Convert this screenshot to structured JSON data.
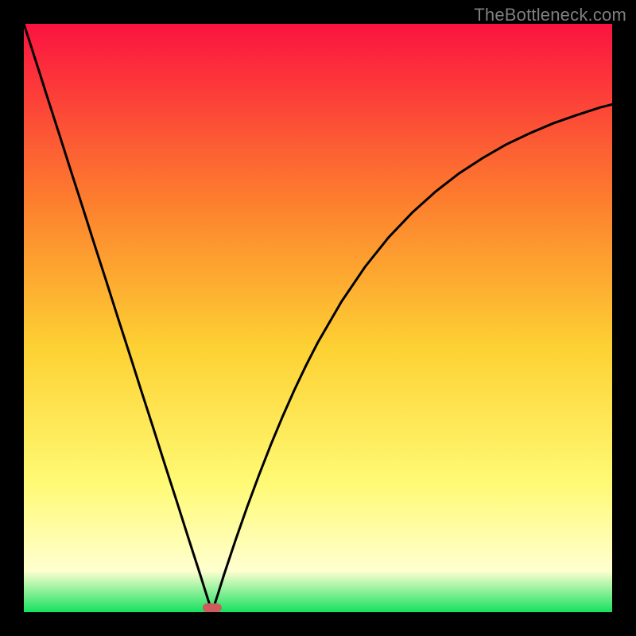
{
  "watermark": "TheBottleneck.com",
  "chart_data": {
    "type": "line",
    "title": "",
    "xlabel": "",
    "ylabel": "",
    "xlim": [
      0,
      100
    ],
    "ylim": [
      0,
      100
    ],
    "grid": false,
    "legend": false,
    "background_gradient": {
      "top": "#fb1340",
      "mid_upper": "#fd7e2e",
      "mid": "#fdd133",
      "mid_lower": "#fffa74",
      "lower": "#ffffd0",
      "bottom": "#16e15f"
    },
    "optimal_marker": {
      "x": 32,
      "color": "#cd5c5c"
    },
    "series": [
      {
        "name": "bottleneck-curve",
        "x": [
          0,
          2,
          4,
          6,
          8,
          10,
          12,
          14,
          16,
          18,
          20,
          22,
          24,
          26,
          28,
          30,
          31,
          32,
          33,
          34,
          36,
          38,
          40,
          42,
          44,
          46,
          48,
          50,
          54,
          58,
          62,
          66,
          70,
          74,
          78,
          82,
          86,
          90,
          94,
          98,
          100
        ],
        "values": [
          100,
          93.8,
          87.5,
          81.3,
          75.0,
          68.8,
          62.5,
          56.3,
          50.0,
          43.8,
          37.5,
          31.3,
          25.0,
          18.8,
          12.5,
          6.3,
          3.1,
          0.0,
          3.1,
          6.3,
          12.3,
          18.0,
          23.4,
          28.5,
          33.3,
          37.8,
          42.0,
          45.9,
          52.8,
          58.7,
          63.7,
          67.9,
          71.5,
          74.6,
          77.2,
          79.5,
          81.4,
          83.1,
          84.5,
          85.8,
          86.3
        ]
      }
    ]
  }
}
